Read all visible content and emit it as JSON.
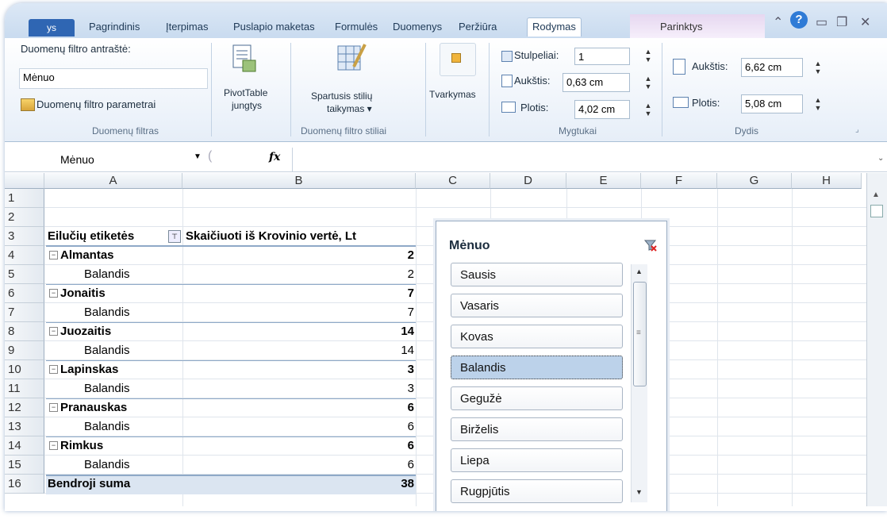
{
  "ribbon": {
    "file_tab": "ys",
    "tabs": [
      "Pagrindinis",
      "Įterpimas",
      "Puslapio maketas",
      "Formulės",
      "Duomenys",
      "Peržiūra",
      "Rodymas"
    ],
    "context_tab": "Parinktys",
    "caption_label": "Duomenų filtro antraštė:",
    "caption_value": "Mėnuo",
    "settings_label": "Duomenų filtro parametrai",
    "group_filter": "Duomenų filtras",
    "pivot_label1": "PivotTable",
    "pivot_label2": "jungtys",
    "styles_label1": "Spartusis stilių",
    "styles_label2": "taikymas ▾",
    "group_styles": "Duomenų filtro stiliai",
    "arrange_label": "Tvarkymas",
    "cols_label": "Stulpeliai:",
    "cols_value": "1",
    "btn_height_label": "Aukštis:",
    "btn_height_value": "0,63 cm",
    "btn_width_label": "Plotis:",
    "btn_width_value": "4,02 cm",
    "group_buttons": "Mygtukai",
    "size_height_label": "Aukštis:",
    "size_height_value": "6,62 cm",
    "size_width_label": "Plotis:",
    "size_width_value": "5,08 cm",
    "group_size": "Dydis"
  },
  "formula_bar": {
    "name_box": "Mėnuo",
    "fx": "fx"
  },
  "columns": [
    "A",
    "B",
    "C",
    "D",
    "E",
    "F",
    "G",
    "H"
  ],
  "rows": [
    "1",
    "2",
    "3",
    "4",
    "5",
    "6",
    "7",
    "8",
    "9",
    "10",
    "11",
    "12",
    "13",
    "14",
    "15",
    "16"
  ],
  "pivot": {
    "header_a": "Eilučių etiketės",
    "header_b": "Skaičiuoti iš Krovinio vertė, Lt",
    "rows": [
      {
        "label": "Almantas",
        "value": "2",
        "bold": true
      },
      {
        "label": "Balandis",
        "value": "2",
        "bold": false
      },
      {
        "label": "Jonaitis",
        "value": "7",
        "bold": true
      },
      {
        "label": "Balandis",
        "value": "7",
        "bold": false
      },
      {
        "label": "Juozaitis",
        "value": "14",
        "bold": true
      },
      {
        "label": "Balandis",
        "value": "14",
        "bold": false
      },
      {
        "label": "Lapinskas",
        "value": "3",
        "bold": true
      },
      {
        "label": "Balandis",
        "value": "3",
        "bold": false
      },
      {
        "label": "Pranauskas",
        "value": "6",
        "bold": true
      },
      {
        "label": "Balandis",
        "value": "6",
        "bold": false
      },
      {
        "label": "Rimkus",
        "value": "6",
        "bold": true
      },
      {
        "label": "Balandis",
        "value": "6",
        "bold": false
      }
    ],
    "total_label": "Bendroji suma",
    "total_value": "38"
  },
  "slicer": {
    "title": "Mėnuo",
    "items": [
      "Sausis",
      "Vasaris",
      "Kovas",
      "Balandis",
      "Gegužė",
      "Birželis",
      "Liepa",
      "Rugpjūtis"
    ],
    "selected": "Balandis"
  },
  "colors": {
    "accent": "#2f66b3",
    "selected": "#bcd2ea",
    "total_bg": "#dbe5f1"
  }
}
